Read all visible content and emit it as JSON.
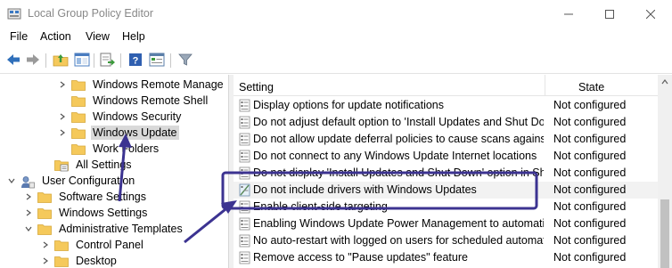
{
  "window": {
    "title": "Local Group Policy Editor",
    "controls": [
      "minimize",
      "maximize",
      "close"
    ]
  },
  "menu": {
    "items": [
      "File",
      "Action",
      "View",
      "Help"
    ]
  },
  "toolbar": {
    "buttons": [
      "back-icon",
      "forward-icon",
      "up-folder-icon",
      "show-hide-tree-icon",
      "export-list-icon",
      "help-icon",
      "properties-icon",
      "filter-icon"
    ]
  },
  "tree": {
    "items": [
      {
        "label": "Windows Remote Manage",
        "type": "folder",
        "expander": "collapsed"
      },
      {
        "label": "Windows Remote Shell",
        "type": "folder",
        "expander": "none"
      },
      {
        "label": "Windows Security",
        "type": "folder",
        "expander": "collapsed"
      },
      {
        "label": "Windows Update",
        "type": "folder",
        "expander": "collapsed",
        "selected": true
      },
      {
        "label": "Work Folders",
        "type": "folder",
        "expander": "none"
      },
      {
        "label": "All Settings",
        "type": "settings",
        "expander": "none"
      },
      {
        "label": "User Configuration",
        "type": "user",
        "expander": "expanded"
      },
      {
        "label": "Software Settings",
        "type": "folder",
        "expander": "collapsed"
      },
      {
        "label": "Windows Settings",
        "type": "folder",
        "expander": "collapsed"
      },
      {
        "label": "Administrative Templates",
        "type": "folder",
        "expander": "expanded"
      },
      {
        "label": "Control Panel",
        "type": "folder",
        "expander": "collapsed"
      },
      {
        "label": "Desktop",
        "type": "folder",
        "expander": "collapsed"
      }
    ]
  },
  "list": {
    "columns": {
      "setting": "Setting",
      "state": "State"
    },
    "rows": [
      {
        "setting": "Display options for update notifications",
        "state": "Not configured"
      },
      {
        "setting": "Do not adjust default option to 'Install Updates and Shut Do...",
        "state": "Not configured"
      },
      {
        "setting": "Do not allow update deferral policies to cause scans against ...",
        "state": "Not configured"
      },
      {
        "setting": "Do not connect to any Windows Update Internet locations",
        "state": "Not configured"
      },
      {
        "setting": "Do not display 'Install Updates and Shut Down' option in Sh...",
        "state": "Not configured"
      },
      {
        "setting": "Do not include drivers with Windows Updates",
        "state": "Not configured",
        "highlighted": true
      },
      {
        "setting": "Enable client-side targeting",
        "state": "Not configured"
      },
      {
        "setting": "Enabling Windows Update Power Management to automati...",
        "state": "Not configured"
      },
      {
        "setting": "No auto-restart with logged on users for scheduled automat...",
        "state": "Not configured"
      },
      {
        "setting": "Remove access to \"Pause updates\" feature",
        "state": "Not configured"
      }
    ]
  },
  "colors": {
    "annotation": "#3c3391",
    "selection": "#d9d9d9",
    "folder": "#f5c95b",
    "toolbar_accent": "#2f6fba"
  }
}
